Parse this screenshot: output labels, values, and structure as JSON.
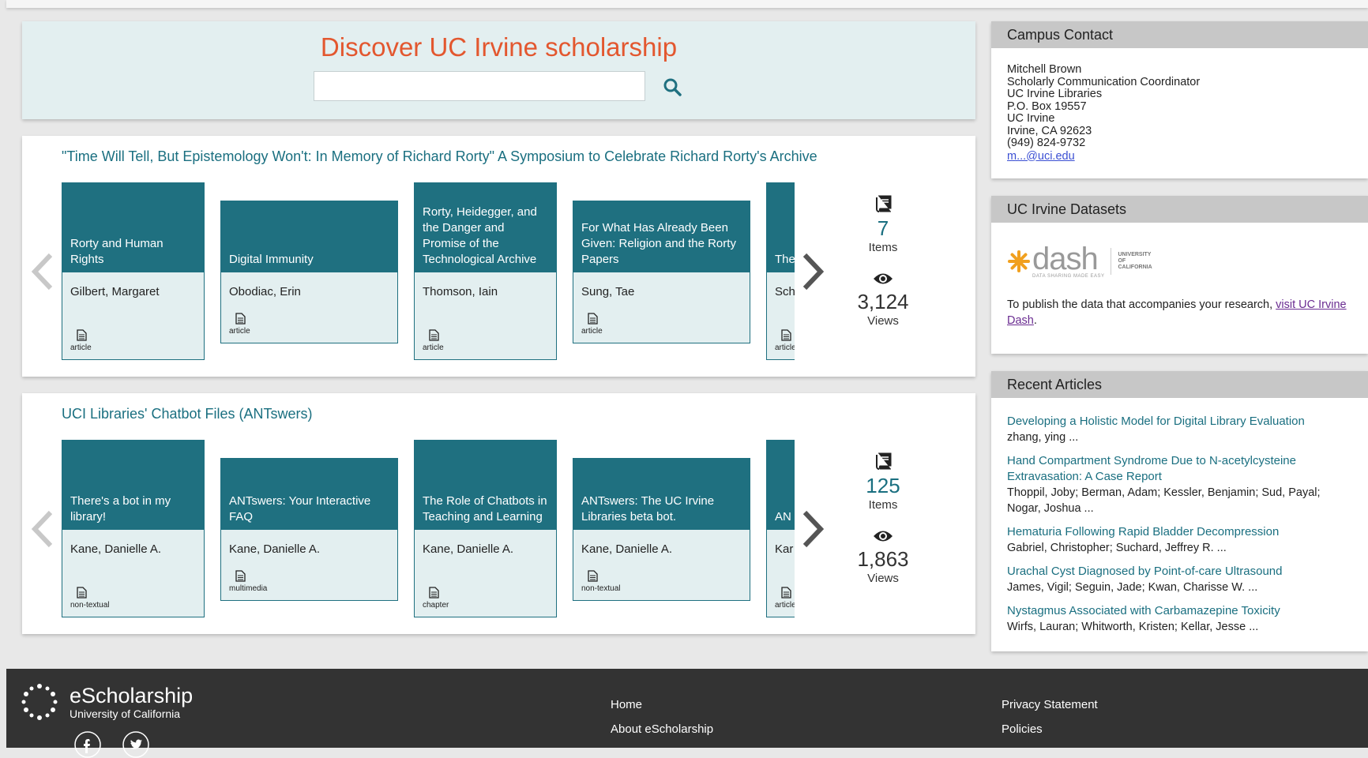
{
  "hero": {
    "title": "Discover UC Irvine scholarship",
    "search_placeholder": ""
  },
  "series": [
    {
      "title": "\"Time Will Tell, But Epistemology Won't: In Memory of Richard Rorty\" A Symposium to Celebrate Richard Rorty's Archive",
      "items_count": "7",
      "items_label": "Items",
      "views_count": "3,124",
      "views_label": "Views",
      "cards": [
        {
          "title": "Rorty and Human Rights",
          "author": "Gilbert, Margaret",
          "type": "article"
        },
        {
          "title": "Digital Immunity",
          "author": "Obodiac, Erin",
          "type": "article"
        },
        {
          "title": "Rorty, Heidegger, and the Danger and Promise of the Technological Archive",
          "author": "Thomson, Iain",
          "type": "article"
        },
        {
          "title": "For What Has Already Been Given: Religion and the Rorty Papers",
          "author": "Sung, Tae",
          "type": "article"
        },
        {
          "title": "The Ma For Rec",
          "author": "Sch",
          "type": "article"
        }
      ]
    },
    {
      "title": "UCI Libraries' Chatbot Files (ANTswers)",
      "items_count": "125",
      "items_label": "Items",
      "views_count": "1,863",
      "views_label": "Views",
      "cards": [
        {
          "title": "There's a bot in my library!",
          "author": "Kane, Danielle A.",
          "type": "non-textual"
        },
        {
          "title": "ANTswers: Your Interactive FAQ",
          "author": "Kane, Danielle A.",
          "type": "multimedia"
        },
        {
          "title": "The Role of Chatbots in Teaching and Learning",
          "author": "Kane, Danielle A.",
          "type": "chapter"
        },
        {
          "title": "ANTswers: The UC Irvine Libraries beta bot.",
          "author": "Kane, Danielle A.",
          "type": "non-textual"
        },
        {
          "title": "AN inte",
          "author": "Kar",
          "type": "article"
        }
      ]
    }
  ],
  "sidebar": {
    "contact": {
      "heading": "Campus Contact",
      "lines": [
        "Mitchell Brown",
        "Scholarly Communication Coordinator",
        "UC Irvine Libraries",
        "P.O. Box 19557",
        "UC Irvine",
        "Irvine, CA 92623",
        "(949) 824-9732"
      ],
      "email": "m...@uci.edu"
    },
    "datasets": {
      "heading": "UC Irvine Datasets",
      "logo_word": "dash",
      "logo_tagline": "DATA SHARING MADE EASY",
      "logo_uc_1": "UNIVERSITY",
      "logo_uc_2": "OF",
      "logo_uc_3": "CALIFORNIA",
      "text_before": "To publish the data that accompanies your research, ",
      "link_text": "visit UC Irvine Dash",
      "text_after": ".",
      "accent_color": "#f1a01e"
    },
    "recent": {
      "heading": "Recent Articles",
      "articles": [
        {
          "title": "Developing a Holistic Model for Digital Library Evaluation",
          "authors": "zhang, ying ..."
        },
        {
          "title": "Hand Compartment Syndrome Due to N-acetylcysteine Extravasation: A Case Report",
          "authors": "Thoppil, Joby; Berman, Adam; Kessler, Benjamin; Sud, Payal; Nogar, Joshua ..."
        },
        {
          "title": "Hematuria Following Rapid Bladder Decompression",
          "authors": "Gabriel, Christopher; Suchard, Jeffrey R. ..."
        },
        {
          "title": "Urachal Cyst Diagnosed by Point-of-care Ultrasound",
          "authors": "James, Vigil; Seguin, Jade; Kwan, Charisse W. ..."
        },
        {
          "title": "Nystagmus Associated with Carbamazepine Toxicity",
          "authors": "Wirfs, Lauran; Whitworth, Kristen; Kellar, Jesse ..."
        }
      ]
    }
  },
  "footer": {
    "brand": "eScholarship",
    "brand_sub": "University of California",
    "links_col1": [
      "Home",
      "About eScholarship"
    ],
    "links_col2": [
      "Privacy Statement",
      "Policies"
    ],
    "social": [
      "facebook-icon",
      "twitter-icon"
    ]
  },
  "colors": {
    "teal": "#1f7080",
    "title_orange": "#e3572f",
    "link_teal": "#1a6f80"
  }
}
